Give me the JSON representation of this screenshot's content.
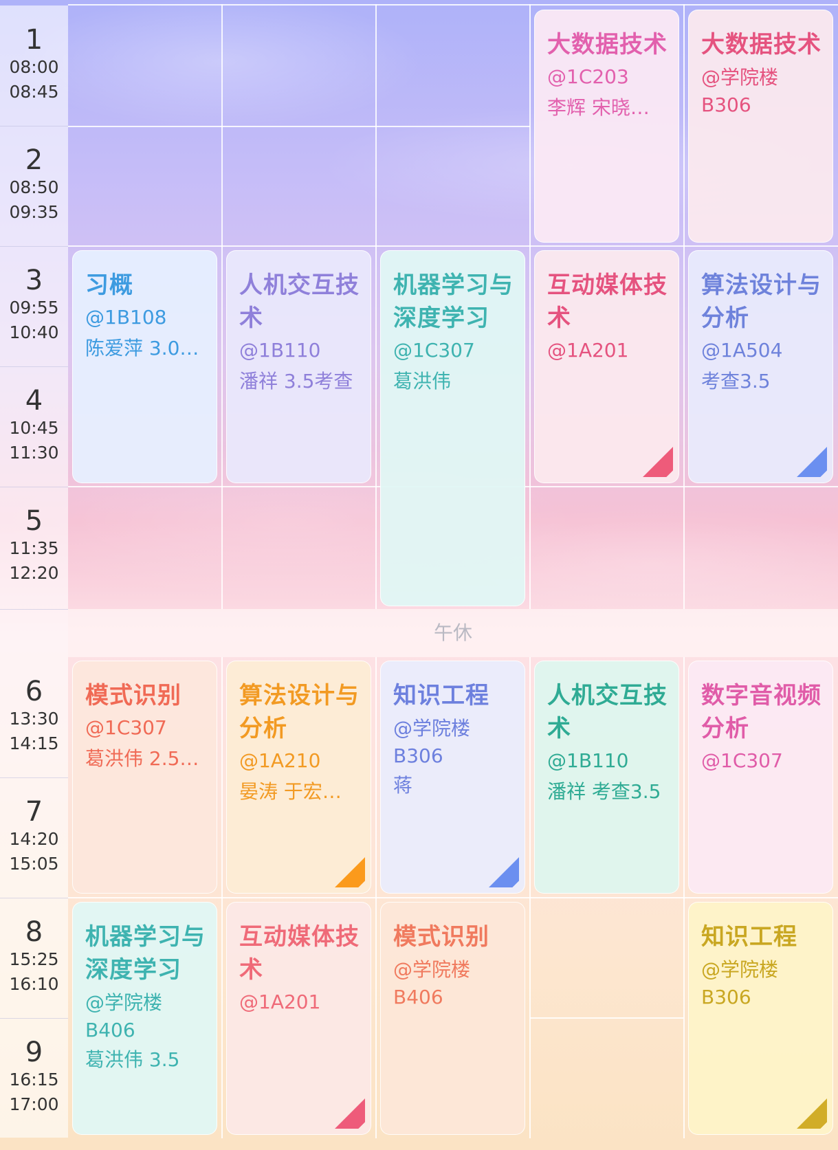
{
  "schedule": {
    "periods": [
      {
        "num": "1",
        "start": "08:00",
        "end": "08:45"
      },
      {
        "num": "2",
        "start": "08:50",
        "end": "09:35"
      },
      {
        "num": "3",
        "start": "09:55",
        "end": "10:40"
      },
      {
        "num": "4",
        "start": "10:45",
        "end": "11:30"
      },
      {
        "num": "5",
        "start": "11:35",
        "end": "12:20"
      },
      {
        "num": "6",
        "start": "13:30",
        "end": "14:15"
      },
      {
        "num": "7",
        "start": "14:20",
        "end": "15:05"
      },
      {
        "num": "8",
        "start": "15:25",
        "end": "16:10"
      },
      {
        "num": "9",
        "start": "16:15",
        "end": "17:00"
      }
    ],
    "lunch_label": "午休",
    "courses": [
      {
        "name": "大数据技术",
        "room": "@1C203",
        "note": "李辉 宋晓…",
        "color": "#e260ad"
      },
      {
        "name": "大数据技术",
        "room": "@学院楼B306",
        "note": "",
        "color": "#e5537f"
      },
      {
        "name": "习概",
        "room": "@1B108",
        "note": "陈爱萍 3.0…",
        "color": "#3d9be0"
      },
      {
        "name": "人机交互技术",
        "room": "@1B110",
        "note": "潘祥 3.5考查",
        "color": "#8f80da"
      },
      {
        "name": "机器学习与深度学习",
        "room": "@1C307",
        "note": "葛洪伟",
        "color": "#3eb3b0"
      },
      {
        "name": "互动媒体技术",
        "room": "@1A201",
        "note": "",
        "color": "#e5537f",
        "corner": "#ee5b7a"
      },
      {
        "name": "算法设计与分析",
        "room": "@1A504",
        "note": "考查3.5",
        "color": "#6e82db",
        "corner": "#6b8ff0"
      },
      {
        "name": "模式识别",
        "room": "@1C307",
        "note": "葛洪伟 2.5…",
        "color": "#f06a55"
      },
      {
        "name": "算法设计与分析",
        "room": "@1A210",
        "note": "晏涛 于宏…",
        "color": "#f29a23",
        "corner": "#fb9a1c"
      },
      {
        "name": "知识工程",
        "room": "@学院楼B306",
        "note": "蒋",
        "color": "#6d80de",
        "corner": "#6b8ff0"
      },
      {
        "name": "人机交互技术",
        "room": "@1B110",
        "note": "潘祥 考查3.5",
        "color": "#2fab94"
      },
      {
        "name": "数字音视频分析",
        "room": "@1C307",
        "note": "",
        "color": "#e05ca8"
      },
      {
        "name": "机器学习与深度学习",
        "room": "@学院楼B406",
        "note": "葛洪伟 3.5",
        "color": "#3eb3b0"
      },
      {
        "name": "互动媒体技术",
        "room": "@1A201",
        "note": "",
        "color": "#ef6a78",
        "corner": "#ee5b7a"
      },
      {
        "name": "模式识别",
        "room": "@学院楼B406",
        "note": "",
        "color": "#f07a5e"
      },
      {
        "name": "知识工程",
        "room": "@学院楼B306",
        "note": "",
        "color": "#c9a722",
        "corner": "#d1ad28"
      }
    ]
  }
}
